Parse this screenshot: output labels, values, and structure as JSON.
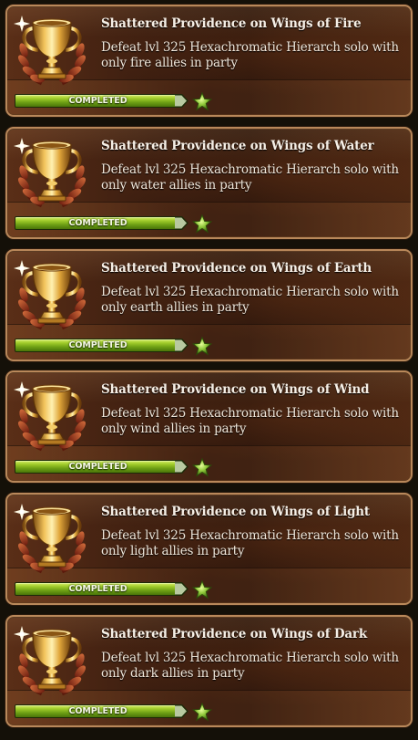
{
  "colors": {
    "frame": "#b9885a",
    "progress_green": "#9fcb2a",
    "star_green": "#8fc83a",
    "trophy_gold": "#e0a63a"
  },
  "trophy_icon": "gold-trophy-cup-with-laurel",
  "status_icon": "green-star",
  "achievements": [
    {
      "title": "Shattered Providence on Wings of Fire",
      "description": "Defeat lvl 325 Hexachromatic Hierarch solo with only fire allies in party",
      "status": "COMPLETED",
      "progress": 1.0
    },
    {
      "title": "Shattered Providence on Wings of Water",
      "description": "Defeat lvl 325 Hexachromatic Hierarch solo with only water allies in party",
      "status": "COMPLETED",
      "progress": 1.0
    },
    {
      "title": "Shattered Providence on Wings of Earth",
      "description": "Defeat lvl 325 Hexachromatic Hierarch solo with only earth allies in party",
      "status": "COMPLETED",
      "progress": 1.0
    },
    {
      "title": "Shattered Providence on Wings of Wind",
      "description": "Defeat lvl 325 Hexachromatic Hierarch solo with only wind allies in party",
      "status": "COMPLETED",
      "progress": 1.0
    },
    {
      "title": "Shattered Providence on Wings of Light",
      "description": "Defeat lvl 325 Hexachromatic Hierarch solo with only light allies in party",
      "status": "COMPLETED",
      "progress": 1.0
    },
    {
      "title": "Shattered Providence on Wings of Dark",
      "description": "Defeat lvl 325 Hexachromatic Hierarch solo with only dark allies in party",
      "status": "COMPLETED",
      "progress": 1.0
    }
  ]
}
